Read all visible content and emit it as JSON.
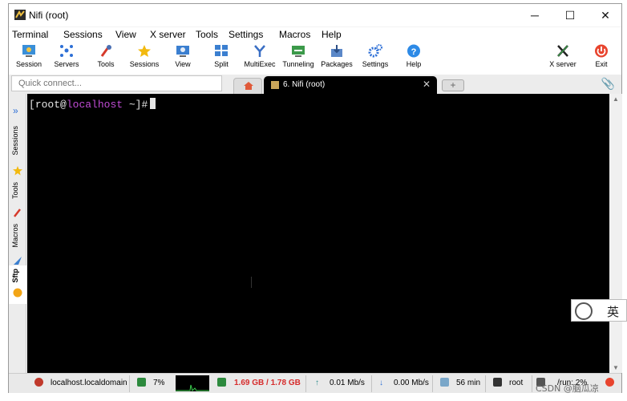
{
  "window": {
    "title": "Nifi (root)",
    "minimize": "─",
    "maximize": "☐",
    "close": "✕"
  },
  "menu": [
    "Terminal",
    "Sessions",
    "View",
    "X server",
    "Tools",
    "Settings",
    "Macros",
    "Help"
  ],
  "toolbar": [
    {
      "label": "Session",
      "icon": "session-icon"
    },
    {
      "label": "Servers",
      "icon": "servers-icon"
    },
    {
      "label": "Tools",
      "icon": "tools-icon"
    },
    {
      "label": "Sessions",
      "icon": "sessions-star-icon"
    },
    {
      "label": "View",
      "icon": "view-icon"
    },
    {
      "label": "Split",
      "icon": "split-icon"
    },
    {
      "label": "MultiExec",
      "icon": "multiexec-icon"
    },
    {
      "label": "Tunneling",
      "icon": "tunneling-icon"
    },
    {
      "label": "Packages",
      "icon": "packages-icon"
    },
    {
      "label": "Settings",
      "icon": "settings-icon"
    },
    {
      "label": "Help",
      "icon": "help-icon"
    },
    {
      "label": "X server",
      "icon": "xserver-icon"
    },
    {
      "label": "Exit",
      "icon": "exit-icon"
    }
  ],
  "quick_connect": {
    "placeholder": "Quick connect..."
  },
  "tabs": {
    "active_label": "6. Nifi (root)",
    "close": "✕",
    "new_tab": "+"
  },
  "sidebar": [
    {
      "label": "Sessions",
      "icon": "star-icon"
    },
    {
      "label": "Tools",
      "icon": "tools-icon"
    },
    {
      "label": "Macros",
      "icon": "macros-icon"
    },
    {
      "label": "Sftp",
      "icon": "sftp-icon"
    }
  ],
  "terminal": {
    "prompt_open": "[",
    "user": "root",
    "at": "@",
    "host": "localhost",
    "path": " ~]#"
  },
  "status": {
    "host": "localhost.localdomain",
    "cpu": "7%",
    "memory": "1.69 GB / 1.78 GB",
    "upload": "0.01 Mb/s",
    "download": "0.00 Mb/s",
    "uptime": "56 min",
    "user": "root",
    "disk": "/run: 2%"
  },
  "ime": {
    "lang": "英"
  },
  "watermark": "CSDN @脑瓜凉",
  "colors": {
    "accent": "#2d6fd6",
    "host": "#c14cd6",
    "mem": "#d62b2b"
  }
}
